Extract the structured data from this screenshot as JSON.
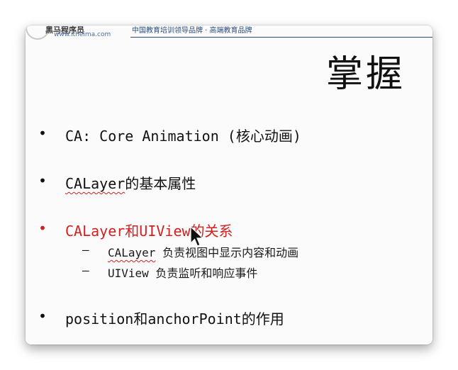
{
  "header": {
    "logo_text": "黑马程序员",
    "logo_url": "www.itheima.com",
    "slogan": "中国教育培训领导品牌 · 高端教育品牌"
  },
  "slide": {
    "title": "掌握",
    "bullets": [
      {
        "marker": "•",
        "text": "CA: Core Animation (核心动画)"
      },
      {
        "marker": "•",
        "text_code": "CALayer",
        "text_rest": "的基本属性"
      },
      {
        "marker": "•",
        "part1": "CALayer",
        "part2": "和",
        "part3": "UIView",
        "part4": "的关系"
      },
      {
        "marker": "•",
        "text_code": "position",
        "text_mid": "和",
        "text_code2": "anchorPoint",
        "text_rest": "的作用"
      }
    ],
    "sub_bullets": [
      {
        "marker": "–",
        "code": "CALayer",
        "rest": " 负责视图中显示内容和动画"
      },
      {
        "marker": "–",
        "code": "UIView",
        "rest": " 负责监听和响应事件"
      }
    ]
  },
  "colors": {
    "highlight": "#d21f1f",
    "text": "#111111",
    "header_blue": "#2a4a7a"
  },
  "icons": {
    "cursor": "mouse-pointer-icon",
    "logo": "itheima-logo-icon"
  }
}
